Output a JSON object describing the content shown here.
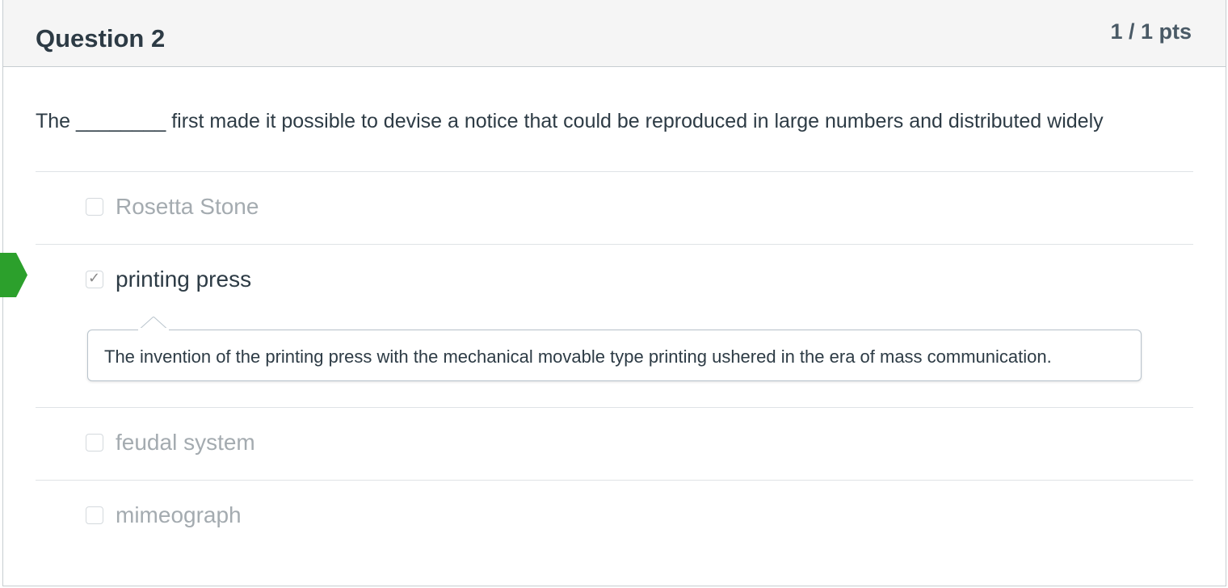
{
  "question": {
    "title": "Question 2",
    "points": "1 / 1 pts",
    "text": "The ________ first made it possible to devise a notice that could be reproduced in large numbers and distributed widely"
  },
  "answers": [
    {
      "label": "Rosetta Stone",
      "checked": false,
      "correct": false
    },
    {
      "label": "printing press",
      "checked": true,
      "correct": true
    },
    {
      "label": "feudal system",
      "checked": false,
      "correct": false
    },
    {
      "label": "mimeograph",
      "checked": false,
      "correct": false
    }
  ],
  "feedback": {
    "comment": "The invention of the printing press with the mechanical movable type printing ushered in the era of mass communication."
  },
  "icons": {
    "checkmark": "check-icon",
    "correct_marker": "correct-answer-arrow-icon"
  },
  "colors": {
    "correct": "#2ca02c",
    "header_bg": "#f5f5f5",
    "muted_text": "#a4abb0"
  }
}
